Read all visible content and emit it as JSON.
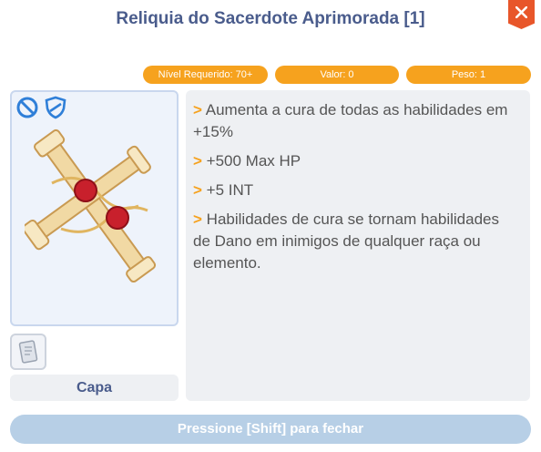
{
  "window": {
    "title": "Reliquia do Sacerdote Aprimorada [1]",
    "close_icon": "close-icon"
  },
  "stats": {
    "required_level": "Nível Requerido: 70+",
    "value": "Valor: 0",
    "weight": "Peso: 1"
  },
  "item": {
    "icons": [
      "no-entry-icon",
      "shield-icon"
    ],
    "type": "Capa"
  },
  "description": {
    "marker": ">",
    "lines": [
      "Aumenta a cura de todas as habilidades em +15%",
      "+500 Max HP",
      "+5 INT",
      "Habilidades de cura se tornam habilidades de Dano em inimigos de qualquer raça ou elemento."
    ]
  },
  "footer": {
    "close_hint": "Pressione [Shift] para fechar"
  },
  "colors": {
    "accent": "#f6a21e",
    "title": "#4a5c8c",
    "close": "#e8562a",
    "icon_blue": "#2f7fd8"
  }
}
